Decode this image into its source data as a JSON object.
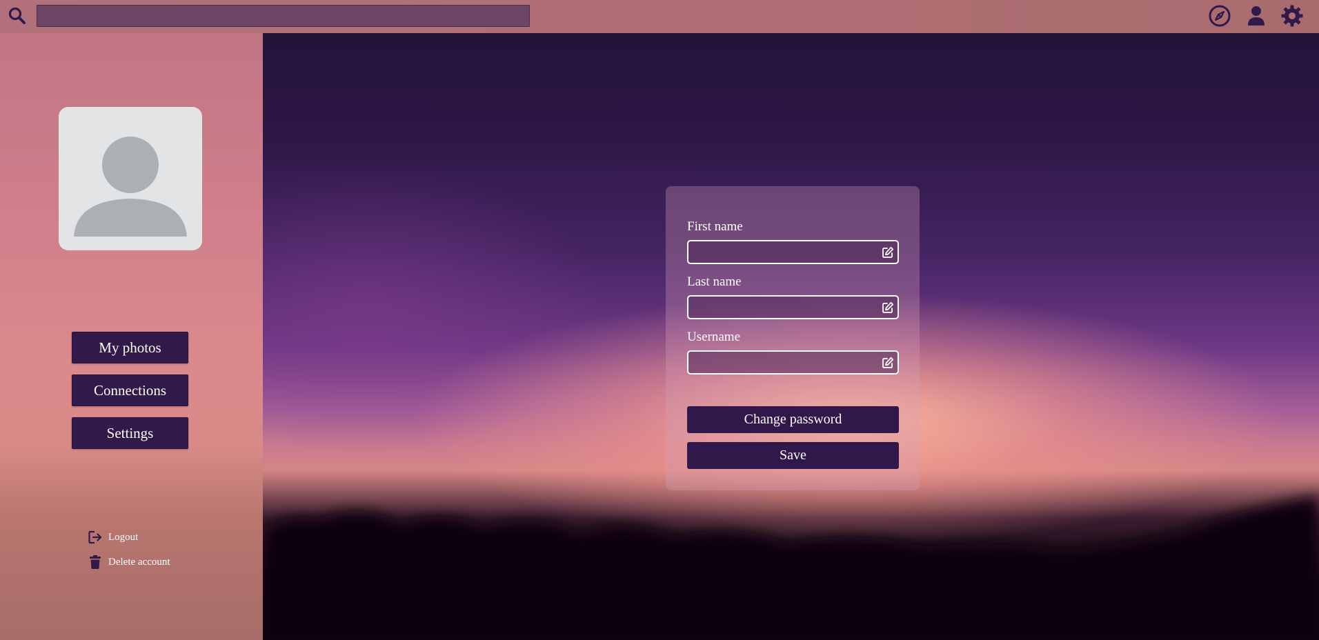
{
  "topbar": {
    "search": {
      "value": "",
      "placeholder": ""
    },
    "icons": [
      "search-icon",
      "compass-icon",
      "user-icon",
      "gear-icon"
    ]
  },
  "sidebar": {
    "avatar": "avatar-placeholder",
    "buttons": [
      {
        "label": "My photos"
      },
      {
        "label": "Connections"
      },
      {
        "label": "Settings"
      }
    ],
    "logout_label": "Logout",
    "delete_label": "Delete account"
  },
  "form": {
    "first_name": {
      "label": "First name",
      "value": ""
    },
    "last_name": {
      "label": "Last name",
      "value": ""
    },
    "username": {
      "label": "Username",
      "value": ""
    },
    "change_password_label": "Change password",
    "save_label": "Save"
  },
  "colors": {
    "accent": "#31194a",
    "topbar": "#b06f74",
    "card": "#d6a0b9"
  }
}
